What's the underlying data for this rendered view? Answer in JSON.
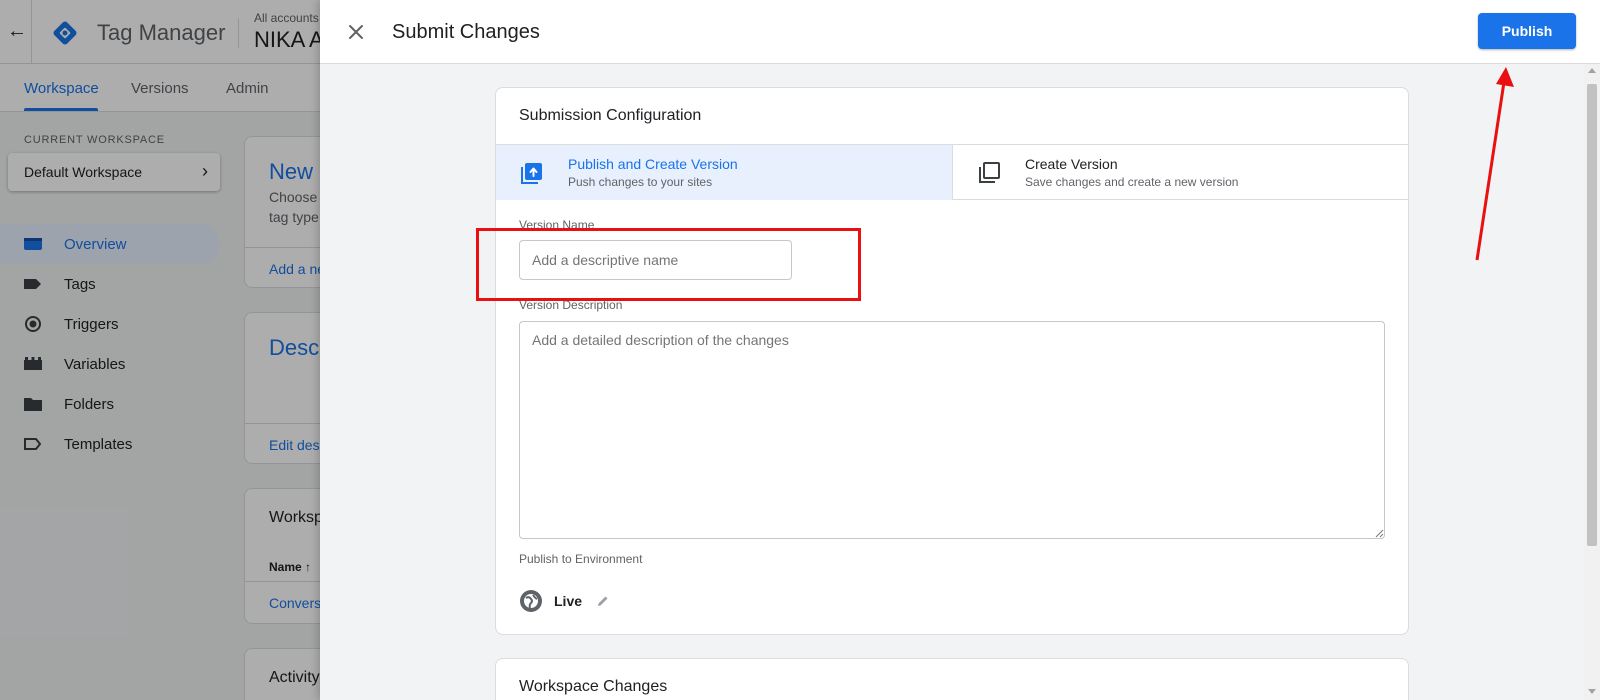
{
  "app": {
    "title": "Tag Manager",
    "account_crumb": "All accounts",
    "account_name": "NIKA A"
  },
  "nav": {
    "tabs": [
      {
        "label": "Workspace",
        "active": true
      },
      {
        "label": "Versions",
        "active": false
      },
      {
        "label": "Admin",
        "active": false
      }
    ]
  },
  "sidebar": {
    "current_workspace_label": "CURRENT WORKSPACE",
    "workspace_name": "Default Workspace",
    "items": [
      {
        "label": "Overview",
        "icon": "overview-icon",
        "active": true
      },
      {
        "label": "Tags",
        "icon": "tag-icon",
        "active": false
      },
      {
        "label": "Triggers",
        "icon": "trigger-icon",
        "active": false
      },
      {
        "label": "Variables",
        "icon": "variables-icon",
        "active": false
      },
      {
        "label": "Folders",
        "icon": "folder-icon",
        "active": false
      },
      {
        "label": "Templates",
        "icon": "templates-icon",
        "active": false
      }
    ]
  },
  "bg_cards": {
    "new_tag_title": "New",
    "new_tag_text_1": "Choose",
    "new_tag_text_2": "tag type",
    "new_tag_link": "Add a ne",
    "desc_title": "Desc",
    "desc_link": "Edit des",
    "workspace_title": "Worksp",
    "workspace_col": "Name ↑",
    "workspace_row": "Convers",
    "activity_title": "Activity"
  },
  "panel": {
    "title": "Submit Changes",
    "publish_label": "Publish",
    "submission_config_title": "Submission Configuration",
    "options": [
      {
        "title": "Publish and Create Version",
        "subtitle": "Push changes to your sites",
        "selected": true
      },
      {
        "title": "Create Version",
        "subtitle": "Save changes and create a new version",
        "selected": false
      }
    ],
    "version_name_label": "Version Name",
    "version_name_placeholder": "Add a descriptive name",
    "version_name_value": "",
    "version_desc_label": "Version Description",
    "version_desc_placeholder": "Add a detailed description of the changes",
    "version_desc_value": "",
    "env_label": "Publish to Environment",
    "env_name": "Live",
    "workspace_changes_title": "Workspace Changes"
  },
  "colors": {
    "accent": "#1a73e8",
    "annotation": "#e81010",
    "selected_bg": "#e8f0fe"
  }
}
